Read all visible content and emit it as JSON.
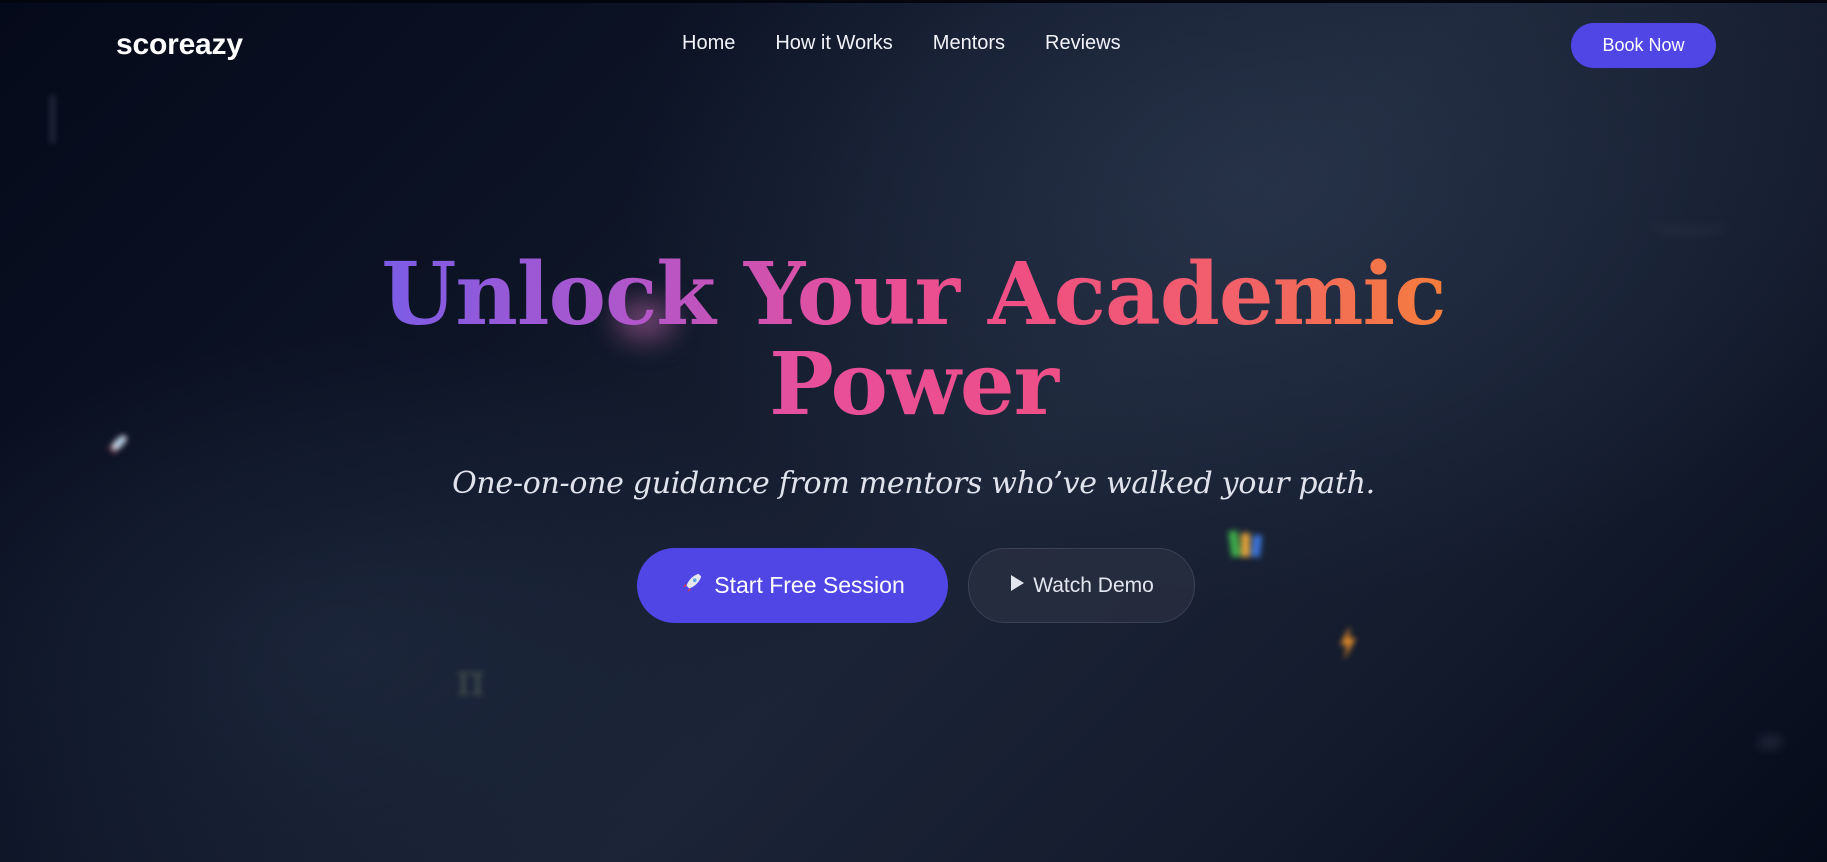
{
  "brand": {
    "name": "scoreazy"
  },
  "nav": {
    "items": [
      {
        "label": "Home"
      },
      {
        "label": "How it Works"
      },
      {
        "label": "Mentors"
      },
      {
        "label": "Reviews"
      }
    ]
  },
  "header": {
    "cta_label": "Book Now"
  },
  "hero": {
    "title_line1": "Unlock Your Academic",
    "title_line2": "Power",
    "subtitle": "One-on-one guidance from mentors who’ve walked your path.",
    "primary_cta": {
      "icon": "rocket-icon",
      "label": "Start Free Session"
    },
    "secondary_cta": {
      "icon": "play-icon",
      "label": "Watch Demo"
    }
  },
  "decorations": {
    "pi_symbol": "π",
    "icons": [
      "rocket-icon",
      "books-icon",
      "lightning-icon"
    ]
  },
  "colors": {
    "accent": "#4f46e5",
    "gradient": [
      "#7b5ce6",
      "#e84f9a",
      "#f47e3b"
    ],
    "background": "#0d1426"
  }
}
